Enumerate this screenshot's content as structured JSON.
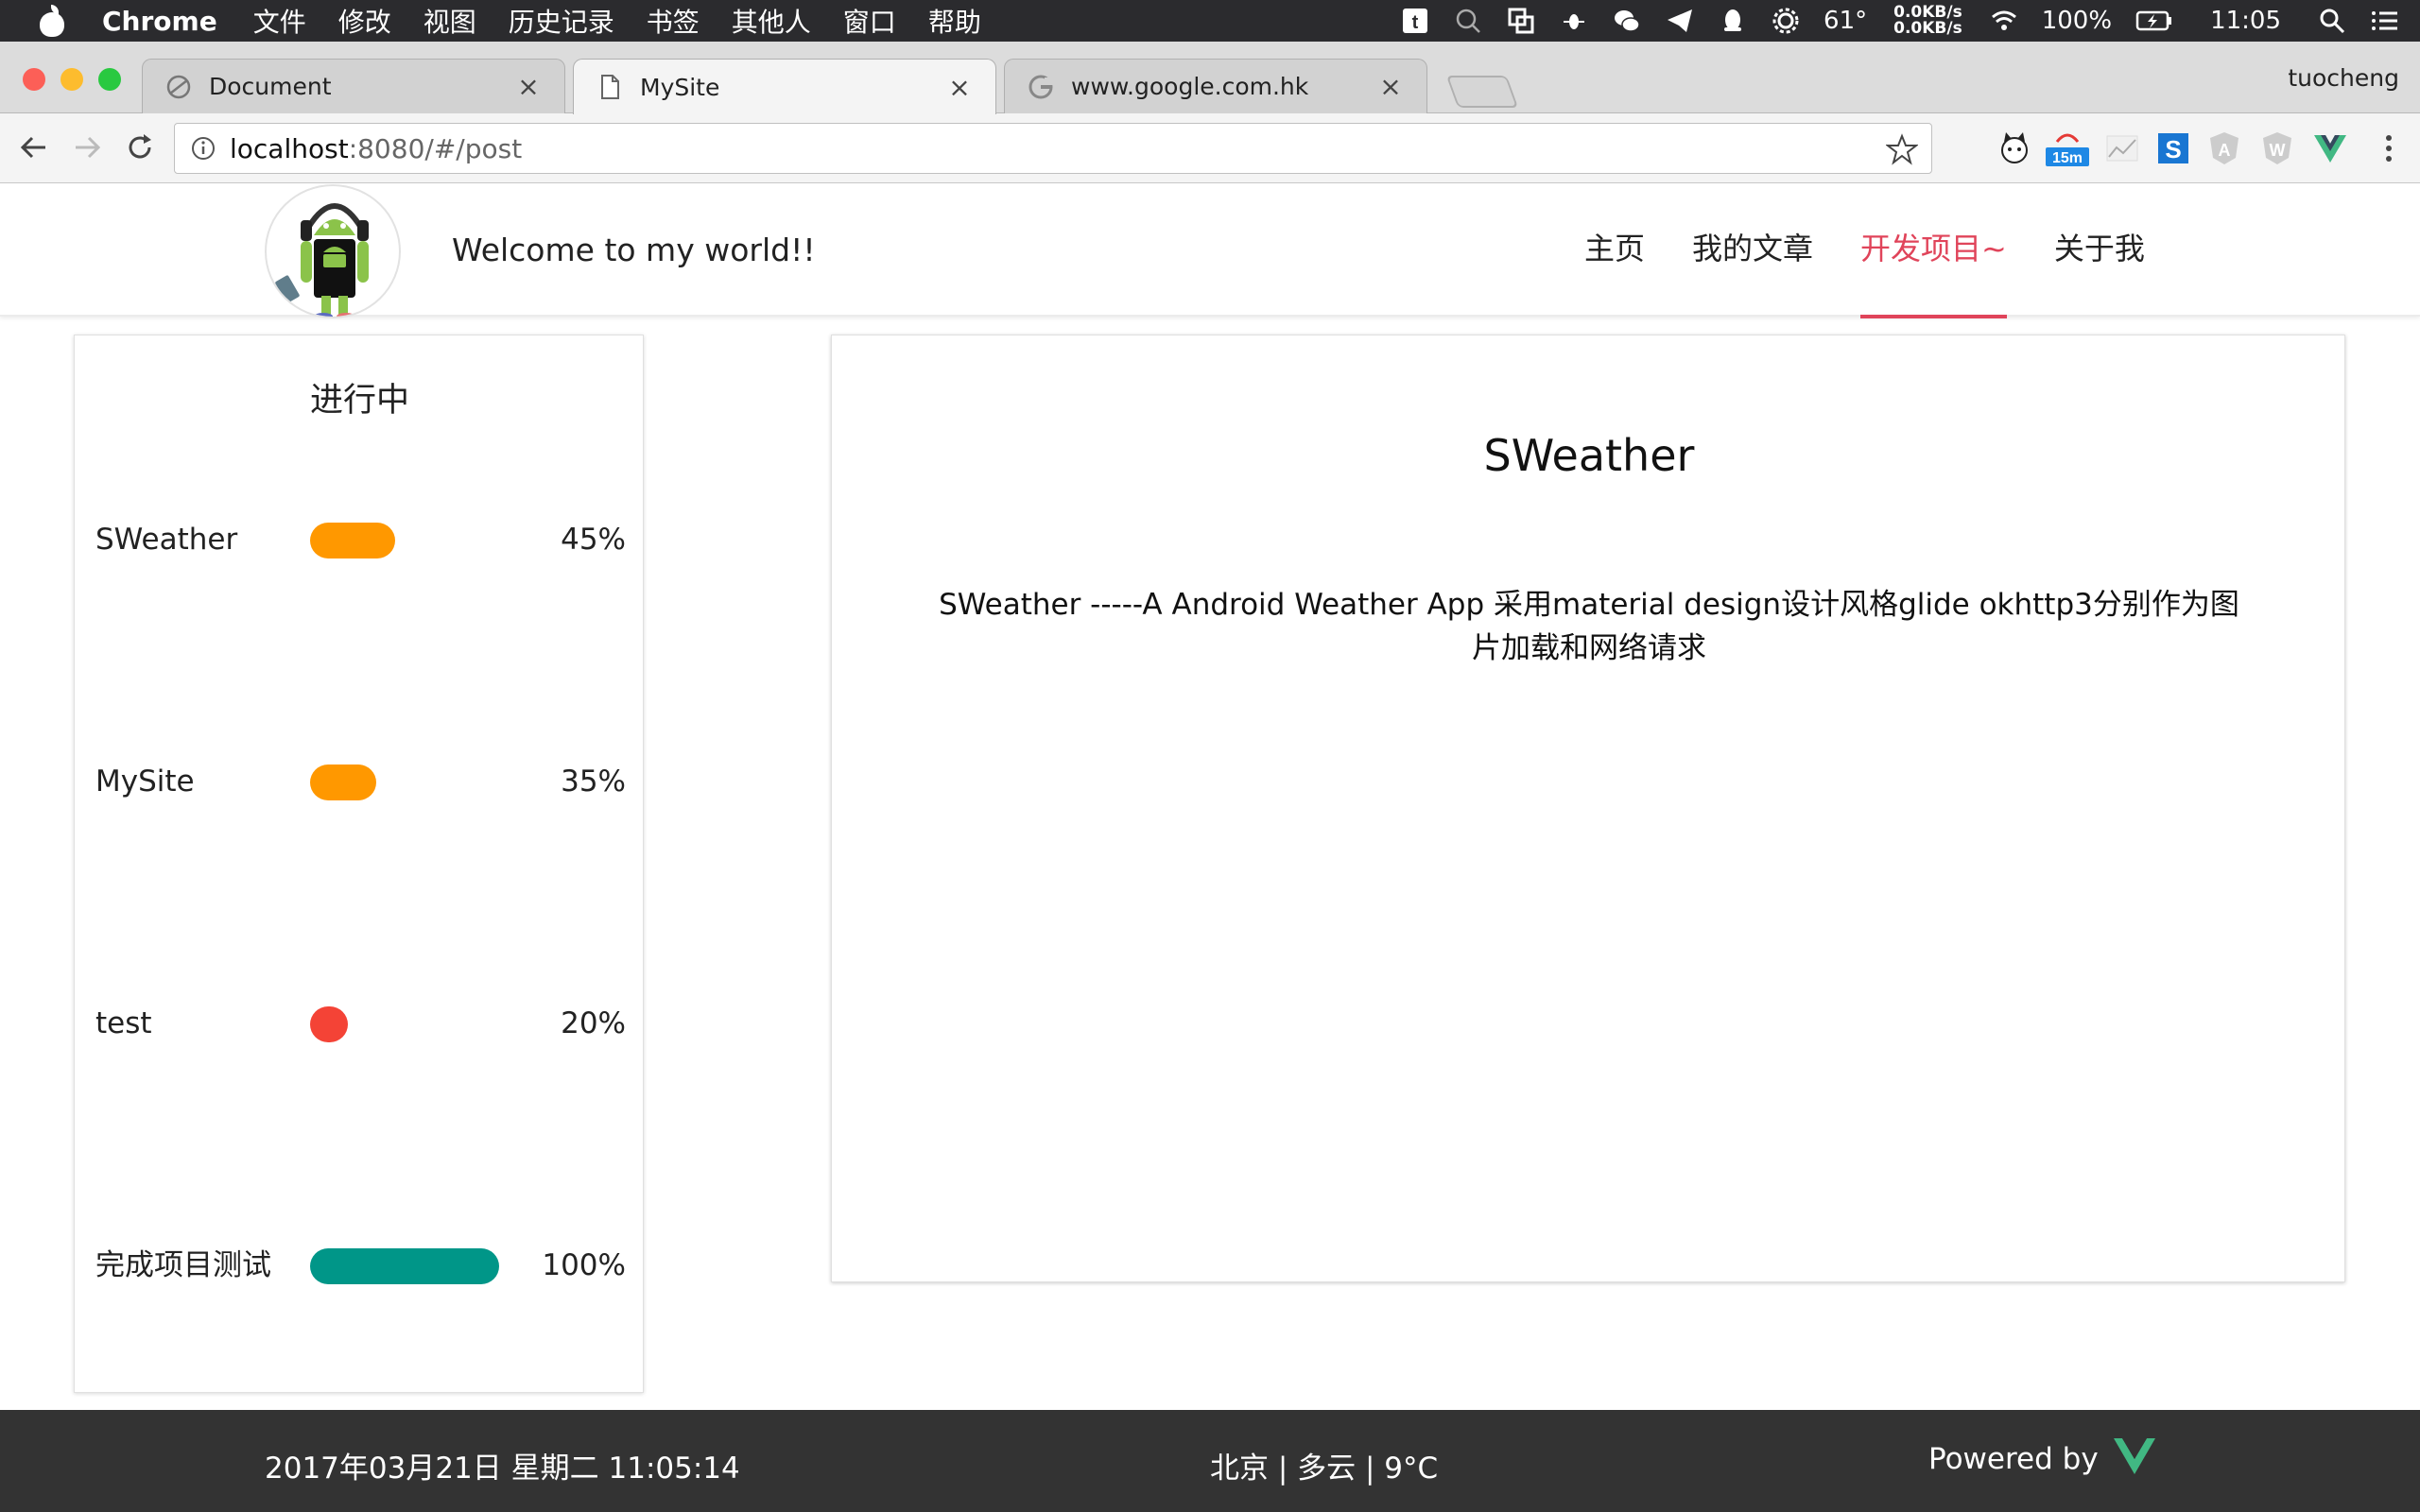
{
  "menubar": {
    "app_name": "Chrome",
    "menus": [
      "文件",
      "修改",
      "视图",
      "历史记录",
      "书签",
      "其他人",
      "窗口",
      "帮助"
    ],
    "temperature": "61°",
    "net_up": "0.0KB/s",
    "net_down": "0.0KB/s",
    "battery": "100%",
    "time": "11:05"
  },
  "browser": {
    "tabs": [
      {
        "title": "Document",
        "icon": "globe-icon"
      },
      {
        "title": "MySite",
        "icon": "page-icon"
      },
      {
        "title": "www.google.com.hk",
        "icon": "google-icon"
      }
    ],
    "active_tab": 1,
    "profile_name": "tuocheng",
    "url_host": "localhost",
    "url_path": ":8080/#/post",
    "extension_badge": "15m"
  },
  "site": {
    "welcome": "Welcome to my world!!",
    "nav": [
      "主页",
      "我的文章",
      "开发项目~",
      "关于我"
    ],
    "active_nav": 2,
    "progress_title": "进行中",
    "projects": [
      {
        "name": "SWeather",
        "percent_label": "45%",
        "percent": 45,
        "color": "#ff9800"
      },
      {
        "name": "MySite",
        "percent_label": "35%",
        "percent": 35,
        "color": "#ff9800"
      },
      {
        "name": "test",
        "percent_label": "20%",
        "percent": 20,
        "color": "#f44336"
      },
      {
        "name": "完成项目测试",
        "percent_label": "100%",
        "percent": 100,
        "color": "#009688"
      }
    ],
    "detail": {
      "title": "SWeather",
      "description": "SWeather -----A Android Weather App 采用material design设计风格glide okhttp3分别作为图片加载和网络请求"
    },
    "footer": {
      "datetime": "2017年03月21日 星期二 11:05:14",
      "weather": "北京 | 多云 | 9°C",
      "powered": "Powered by"
    },
    "accent_color": "#e0445a"
  }
}
